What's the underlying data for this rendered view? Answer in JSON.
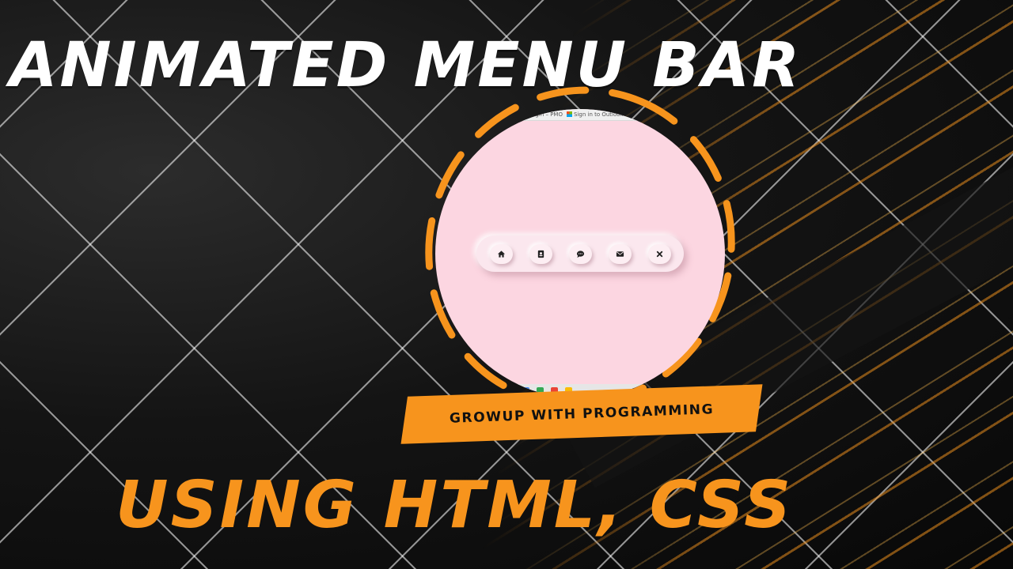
{
  "title": "ANIMATED  MENU BAR",
  "subtitle": "USING HTML, CSS",
  "banner": "GROWUP WITH PROGRAMMING",
  "browser_bar": {
    "bookmark1": "ngin – PMO",
    "bookmark2": "Sign in to Outlook"
  },
  "menu": {
    "items": [
      {
        "icon": "home-icon"
      },
      {
        "icon": "contact-card-icon"
      },
      {
        "icon": "chat-icon"
      },
      {
        "icon": "envelope-icon"
      },
      {
        "icon": "close-icon"
      }
    ]
  },
  "colors": {
    "accent_orange": "#f7941d",
    "screen_pink": "#fcd6e1",
    "title_white": "#ffffff",
    "background_dark": "#0b0b0b"
  }
}
